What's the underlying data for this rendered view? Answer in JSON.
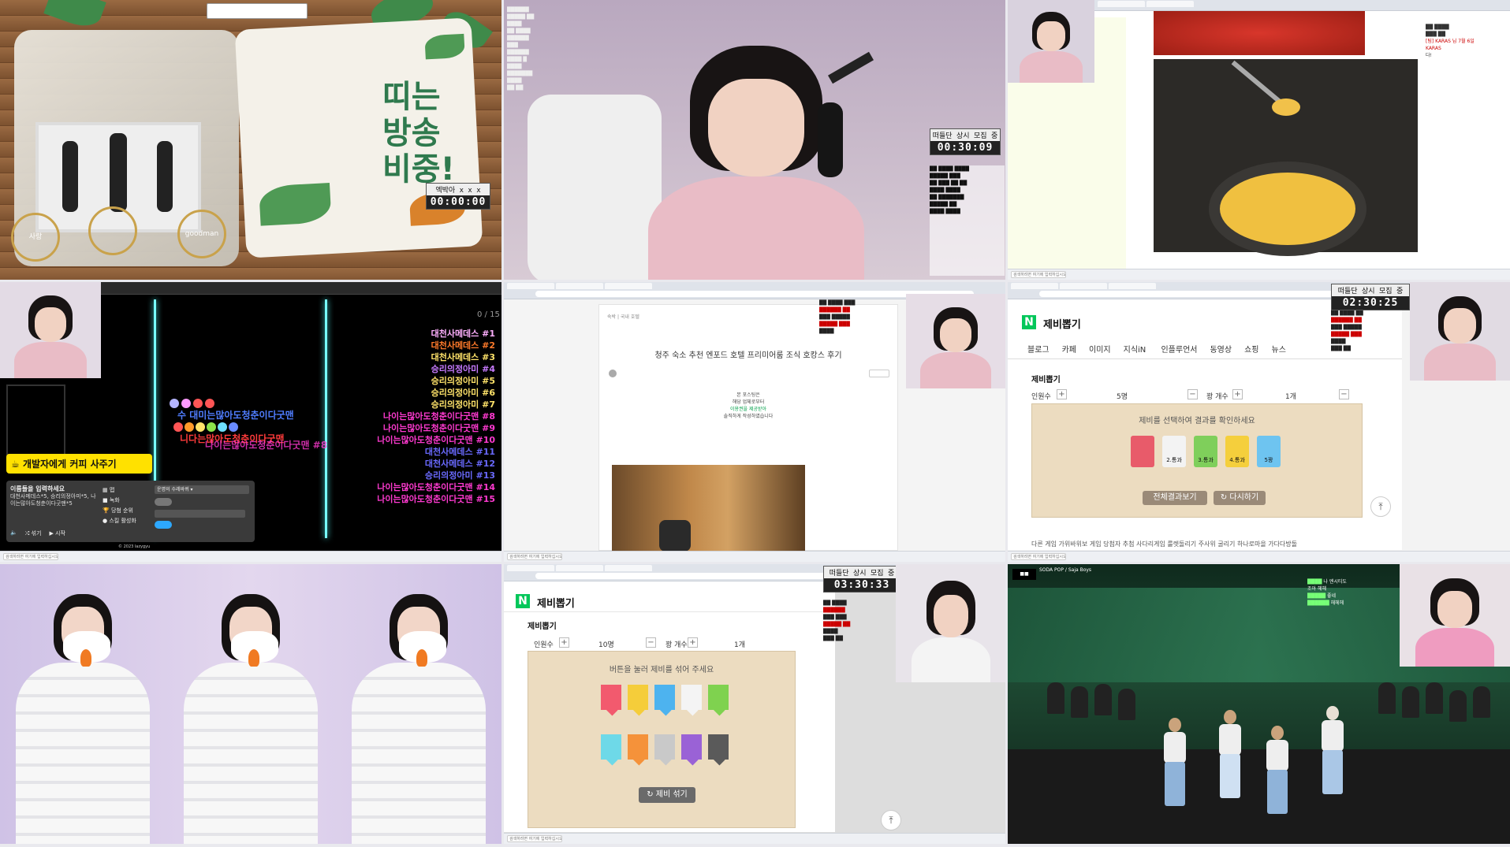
{
  "taskbar": {
    "search_placeholder": "검색하려면 여기에 입력하십시오"
  },
  "cell1": {
    "card_text": [
      "띠는",
      "방송",
      "비중!"
    ],
    "nick": "엑박아 x x x",
    "timer": "00:00:00",
    "medals": [
      "사랑",
      "",
      "goodman"
    ]
  },
  "cell2": {
    "timer_label": "떠들단 상시 모집 중",
    "timer": "00:30:09"
  },
  "cell3": {
    "chat": [
      "[팀] KARAS 님 7월 6일",
      "KARAS",
      "다!"
    ]
  },
  "cell4": {
    "counter": "0 / 15",
    "lyrics": [
      {
        "text": "수 대미는많아도청춘이다굿맨",
        "color": "#4f7dff"
      },
      {
        "text": "니다는많아도청춘이다굿맨",
        "color": "#ff3b3b"
      },
      {
        "text": "나이는많아도청춘이다굿맨 #8",
        "color": "#ff3ad0"
      }
    ],
    "ranks": [
      {
        "text": "대천사메데스 #1",
        "color": "#ffb0ff"
      },
      {
        "text": "대천사메데스 #2",
        "color": "#ff7a2a"
      },
      {
        "text": "대천사메데스 #3",
        "color": "#ffe36a"
      },
      {
        "text": "승리의정아미 #4",
        "color": "#c77bff"
      },
      {
        "text": "승리의정아미 #5",
        "color": "#ffe36a"
      },
      {
        "text": "승리의정아미 #6",
        "color": "#ffe36a"
      },
      {
        "text": "승리의정아미 #7",
        "color": "#ffe36a"
      },
      {
        "text": "나이는많아도청춘이다굿맨 #8",
        "color": "#ff3ad0"
      },
      {
        "text": "나이는많아도청춘이다굿맨 #9",
        "color": "#ff3ad0"
      },
      {
        "text": "나이는많아도청춘이다굿맨 #10",
        "color": "#ff3ad0"
      },
      {
        "text": "대천사메데스 #11",
        "color": "#6a6aff"
      },
      {
        "text": "대천사메데스 #12",
        "color": "#6a6aff"
      },
      {
        "text": "승리의정아미 #13",
        "color": "#6a6aff"
      },
      {
        "text": "나이는많아도청춘이다굿맨 #14",
        "color": "#ff3ad0"
      },
      {
        "text": "나이는많아도청춘이다굿맨 #15",
        "color": "#ff3ad0"
      }
    ],
    "coffee": "개발자에게 커피 사주기",
    "panel": {
      "title": "이름들을 입력하세요",
      "names": "대천사메데스*5, 승리의정아미*5, 나이는많아도청춘이다굿맨*5",
      "opt1": "맵",
      "opt2": "녹화",
      "opt3": "당첨 순위",
      "opt4": "스킬 활성화",
      "shuffle": "섞기",
      "start": "시작",
      "select": "운명의 수레바퀴"
    },
    "footer": "© 2023 lazygyu"
  },
  "cell5": {
    "blog_label": "숙박 | 국내 호텔",
    "title": "청주 숙소 추천 엔포드 호텔 프리미어룸 조식 호캉스 후기",
    "quote": [
      "본 포스팅은",
      "해당 업체로부터",
      "이용권을 제공받아",
      "솔직하게 작성하였습니다"
    ]
  },
  "cell6": {
    "timer_label": "떠들단 상시 모집 중",
    "timer": "02:30:25",
    "title": "제비뽑기",
    "nav": [
      "블로그",
      "카페",
      "이미지",
      "지식iN",
      "인플루언서",
      "동영상",
      "쇼핑",
      "뉴스"
    ],
    "section": "제비뽑기",
    "people_label": "인원수",
    "people": "5명",
    "win_label": "꽝 개수",
    "win": "1개",
    "instruction": "제비를 선택하여 결과를 확인하세요",
    "results": [
      {
        "label": "",
        "color": "#e85b6a"
      },
      {
        "label": "2.통과",
        "color": "#f3f3f3"
      },
      {
        "label": "3.통과",
        "color": "#7fcf5b"
      },
      {
        "label": "4.통과",
        "color": "#f5cf3c"
      },
      {
        "label": "5꽝",
        "color": "#6ec4f0"
      }
    ],
    "btn_all": "전체결과보기",
    "btn_retry": "다시하기",
    "bottom_links": "다른 게임  가위바위보 게임  당첨자 추첨  사다리게임  룰렛돌리기  주사위 굴리기  하나로마을 가다다방돌"
  },
  "cell8": {
    "timer_label": "떠들단 상시 모집 중",
    "timer": "03:30:33",
    "title": "제비뽑기",
    "section": "제비뽑기",
    "people_label": "인원수",
    "people": "10명",
    "win_label": "꽝 개수",
    "win": "1개",
    "instruction": "버튼을 눌러 제비를 섞어 주세요",
    "papers_row1": [
      "#f25a6e",
      "#f5cd3a",
      "#4db3ef",
      "#f4f4f4",
      "#7fd24f"
    ],
    "papers_row2": [
      "#6ed9e8",
      "#f5923a",
      "#c9c9c9",
      "#9a62d6",
      "#5a5a5a"
    ],
    "shuffle": "제비 섞기"
  },
  "cell9": {
    "header": "SODA POP / Saja Boys",
    "chat": [
      "나 엔시티도",
      "조아 헤헤",
      "좋네",
      "헤헤헤"
    ]
  }
}
